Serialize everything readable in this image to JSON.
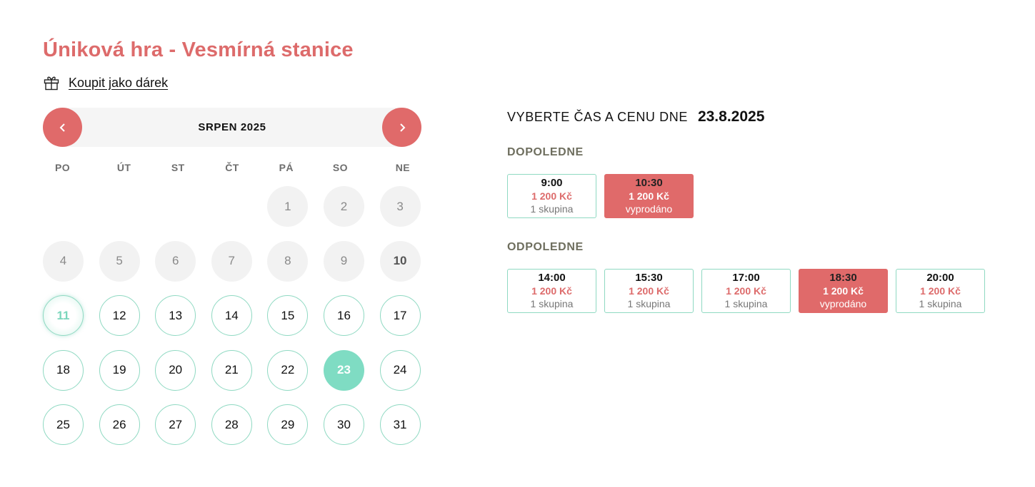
{
  "page": {
    "title": "Úniková hra - Vesmírná stanice",
    "gift_link": "Koupit jako dárek"
  },
  "calendar": {
    "month": "SRPEN 2025",
    "weekdays": [
      "PO",
      "ÚT",
      "ST",
      "ČT",
      "PÁ",
      "SO",
      "NE"
    ],
    "days": [
      {
        "label": "",
        "state": "empty"
      },
      {
        "label": "",
        "state": "empty"
      },
      {
        "label": "",
        "state": "empty"
      },
      {
        "label": "",
        "state": "empty"
      },
      {
        "label": "1",
        "state": "past"
      },
      {
        "label": "2",
        "state": "past"
      },
      {
        "label": "3",
        "state": "past"
      },
      {
        "label": "4",
        "state": "past"
      },
      {
        "label": "5",
        "state": "past"
      },
      {
        "label": "6",
        "state": "past"
      },
      {
        "label": "7",
        "state": "past"
      },
      {
        "label": "8",
        "state": "past"
      },
      {
        "label": "9",
        "state": "past"
      },
      {
        "label": "10",
        "state": "past bold"
      },
      {
        "label": "11",
        "state": "today"
      },
      {
        "label": "12",
        "state": "avail"
      },
      {
        "label": "13",
        "state": "avail"
      },
      {
        "label": "14",
        "state": "avail"
      },
      {
        "label": "15",
        "state": "avail"
      },
      {
        "label": "16",
        "state": "avail"
      },
      {
        "label": "17",
        "state": "avail"
      },
      {
        "label": "18",
        "state": "avail"
      },
      {
        "label": "19",
        "state": "avail"
      },
      {
        "label": "20",
        "state": "avail"
      },
      {
        "label": "21",
        "state": "avail"
      },
      {
        "label": "22",
        "state": "avail"
      },
      {
        "label": "23",
        "state": "selected"
      },
      {
        "label": "24",
        "state": "avail"
      },
      {
        "label": "25",
        "state": "avail"
      },
      {
        "label": "26",
        "state": "avail"
      },
      {
        "label": "27",
        "state": "avail"
      },
      {
        "label": "28",
        "state": "avail"
      },
      {
        "label": "29",
        "state": "avail"
      },
      {
        "label": "30",
        "state": "avail"
      },
      {
        "label": "31",
        "state": "avail"
      }
    ]
  },
  "selection": {
    "label": "VYBERTE ČAS A CENU DNE",
    "date": "23.8.2025"
  },
  "sections": [
    {
      "title": "DOPOLEDNE",
      "slots": [
        {
          "time": "9:00",
          "price": "1 200 Kč",
          "status": "1 skupina",
          "sold_out": false
        },
        {
          "time": "10:30",
          "price": "1 200 Kč",
          "status": "vyprodáno",
          "sold_out": true
        }
      ]
    },
    {
      "title": "ODPOLEDNE",
      "slots": [
        {
          "time": "14:00",
          "price": "1 200 Kč",
          "status": "1 skupina",
          "sold_out": false
        },
        {
          "time": "15:30",
          "price": "1 200 Kč",
          "status": "1 skupina",
          "sold_out": false
        },
        {
          "time": "17:00",
          "price": "1 200 Kč",
          "status": "1 skupina",
          "sold_out": false
        },
        {
          "time": "18:30",
          "price": "1 200 Kč",
          "status": "vyprodáno",
          "sold_out": true
        },
        {
          "time": "20:00",
          "price": "1 200 Kč",
          "status": "1 skupina",
          "sold_out": false
        }
      ]
    }
  ],
  "colors": {
    "accent_red": "#e06a6a",
    "title_red": "#dd6b6b",
    "mint": "#7fdcc3",
    "mint_border": "#8fd9c2"
  },
  "icons": {
    "gift": "gift-icon",
    "prev": "chevron-left-icon",
    "next": "chevron-right-icon"
  }
}
